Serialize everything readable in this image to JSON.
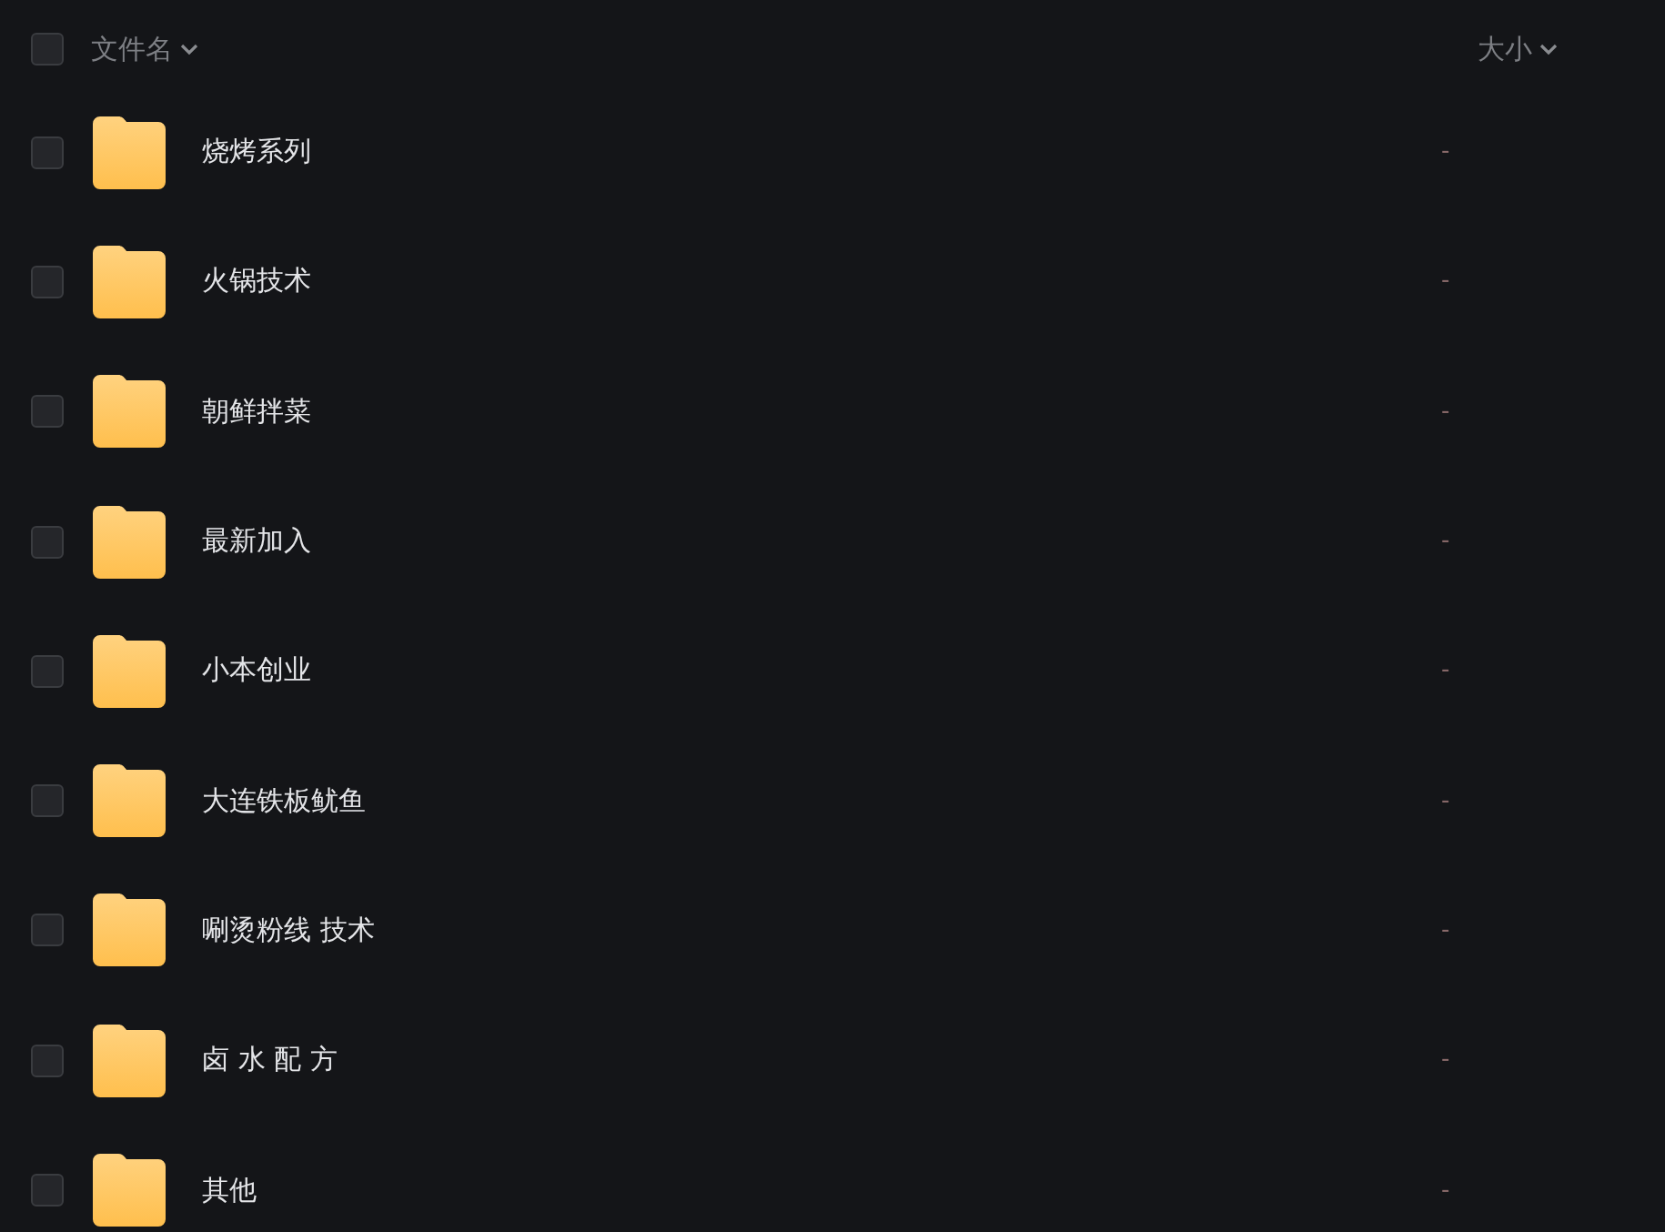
{
  "header": {
    "select_all_checked": false,
    "name_label": "文件名",
    "size_label": "大小"
  },
  "files": [
    {
      "name": "烧烤系列",
      "size": "-",
      "checked": false
    },
    {
      "name": "火锅技术",
      "size": "-",
      "checked": false
    },
    {
      "name": "朝鲜拌菜",
      "size": "-",
      "checked": false
    },
    {
      "name": "最新加入",
      "size": "-",
      "checked": false
    },
    {
      "name": "小本创业",
      "size": "-",
      "checked": false
    },
    {
      "name": "大连铁板鱿鱼",
      "size": "-",
      "checked": false
    },
    {
      "name": "唰烫粉线 技术",
      "size": "-",
      "checked": false
    },
    {
      "name": "卤 水 配 方",
      "size": "-",
      "checked": false
    },
    {
      "name": "其他",
      "size": "-",
      "checked": false
    }
  ]
}
